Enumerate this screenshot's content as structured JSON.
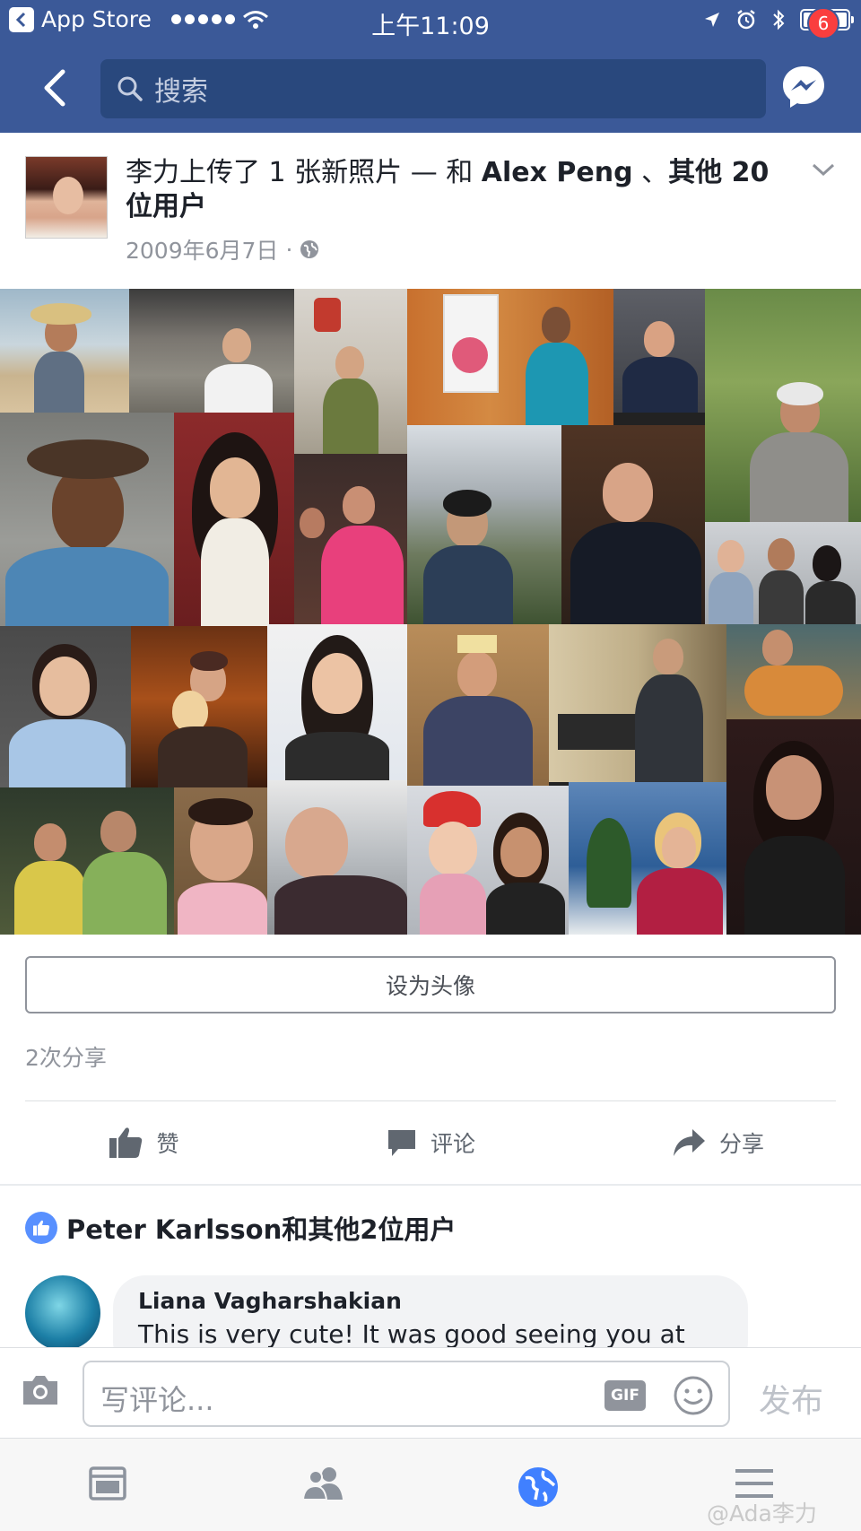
{
  "status_bar": {
    "back_app": "App Store",
    "time": "上午11:09"
  },
  "nav": {
    "search_placeholder": "搜索",
    "messenger_badge": "6"
  },
  "post": {
    "title_prefix": "李力上传了 1 张新照片 — 和 ",
    "tagged_user": "Alex Peng",
    "title_middle": " 、",
    "others": "其他 20 位用户",
    "date": "2009年6月7日",
    "privacy_separator": "·"
  },
  "actions": {
    "set_avatar": "设为头像",
    "share_count": "2次分享",
    "like": "赞",
    "comment": "评论",
    "share": "分享"
  },
  "likes": {
    "summary": "Peter Karlsson和其他2位用户"
  },
  "comment": {
    "author": "Liana Vagharshakian",
    "text": "This is very cute!  It was good seeing you at"
  },
  "composer": {
    "placeholder": "写评论...",
    "gif": "GIF",
    "publish": "发布"
  },
  "tabbar": {
    "items": [
      "feed-icon",
      "friends-icon",
      "globe-icon",
      "menu-icon"
    ],
    "active": "globe-icon"
  },
  "watermark": "@Ada李力",
  "colors": {
    "brand": "#3b5998",
    "search_bg": "#29487d",
    "badge": "#fa3e3e",
    "like": "#5890ff",
    "active_tab": "#4080ff"
  }
}
